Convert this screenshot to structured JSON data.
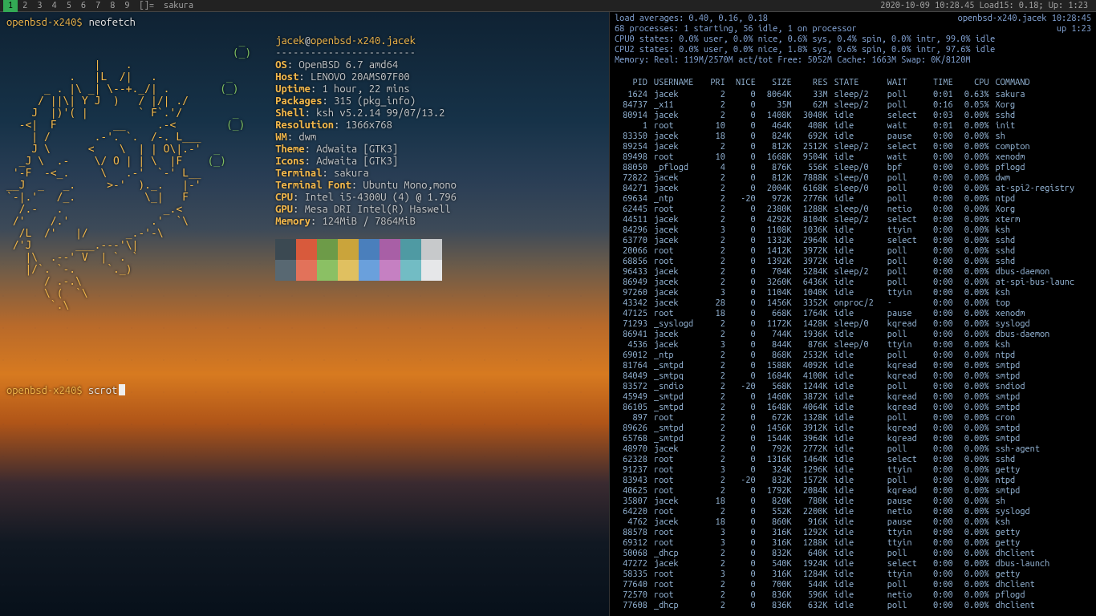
{
  "bar": {
    "tags": [
      "1",
      "2",
      "3",
      "4",
      "5",
      "6",
      "7",
      "8",
      "9"
    ],
    "selected_tag": "1",
    "layout": "[]=",
    "window_title": "sakura",
    "status": "2020-10-09 10:28.45 Load15: 0.18; Up:   1:23"
  },
  "left": {
    "ps1": "openbsd-x240$",
    "cmd1": "neofetch",
    "cmd2": "scrot",
    "ascii": "                                     _\n                                    (_)\n              |    .\n          .   |L  /|   .           _\n      _ . |\\ _| \\--+._/| .        (_)\n     / ||\\| Y J  )   / |/| ./\n    J  |)'( |        ` F`.'/        _\n  -<|  F         __     .-<        (_)\n    | /       .-'. `.  /-. L___\n    J \\      <    \\  | | O\\|.-'  _\n  _J \\  .-    \\/ O | | \\  |F    (_)\n '-F  -<_.     \\   .-'  `-' L__\n__J  _   _.     >-'  )._.   |-'\n`-|.'   /_.           \\_|   F\n  /.-   .                _.<\n /'    /.'             .'  `\\\n  /L  /'   |/      _.-'-\\\n /'J       ___.---'\\|\n   |\\  .--' V  | `. `\n   |/`. `-.     `._)\n      / .-.\\\n      \\ (  `\\\n       `.\\",
    "user": "jacek",
    "host": "openbsd-x240.jacek",
    "sep": "------------------------",
    "fields": [
      [
        "OS",
        "OpenBSD 6.7 amd64"
      ],
      [
        "Host",
        "LENOVO 20AMS07F00"
      ],
      [
        "Uptime",
        "1 hour, 22 mins"
      ],
      [
        "Packages",
        "315 (pkg_info)"
      ],
      [
        "Shell",
        "ksh v5.2.14 99/07/13.2"
      ],
      [
        "Resolution",
        "1366x768"
      ],
      [
        "WM",
        "dwm"
      ],
      [
        "Theme",
        "Adwaita [GTK3]"
      ],
      [
        "Icons",
        "Adwaita [GTK3]"
      ],
      [
        "Terminal",
        "sakura"
      ],
      [
        "Terminal Font",
        "Ubuntu Mono,mono"
      ],
      [
        "CPU",
        "Intel i5-4300U (4) @ 1.796"
      ],
      [
        "GPU",
        "Mesa DRI Intel(R) Haswell"
      ],
      [
        "Memory",
        "124MiB / 7864MiB"
      ]
    ],
    "swatches1": [
      "#3b4952",
      "#d85a3c",
      "#6d9b48",
      "#caa43b",
      "#4a7fbc",
      "#a85fa6",
      "#4f9aa3",
      "#c7c9cb"
    ],
    "swatches2": [
      "#586872",
      "#e2725a",
      "#8bc064",
      "#e0c060",
      "#6aa0dc",
      "#c580c2",
      "#72bcc4",
      "#e6e7e9"
    ]
  },
  "right": {
    "head1_left": "load averages:  0.40,  0.16,  0.18",
    "head1_right": "openbsd-x240.jacek 10:28:45",
    "head2_left": "68 processes: 1 starting, 56 idle, 1 on processor",
    "head2_right": "up  1:23",
    "cpu0": "CPU0 states:  0.0% user,  0.0% nice,  0.6% sys,  0.4% spin,  0.0% intr, 99.0% idle",
    "cpu2": "CPU2 states:  0.0% user,  0.0% nice,  1.8% sys,  0.6% spin,  0.0% intr, 97.6% idle",
    "mem": "Memory: Real: 119M/2570M act/tot Free: 5052M Cache: 1663M Swap: 0K/8120M",
    "cols": [
      "PID",
      "USERNAME",
      "PRI",
      "NICE",
      "SIZE",
      "RES",
      "STATE",
      "WAIT",
      "TIME",
      "CPU",
      "COMMAND"
    ],
    "rows": [
      [
        "1624",
        "jacek",
        "2",
        "0",
        "8064K",
        "33M",
        "sleep/2",
        "poll",
        "0:01",
        "0.63%",
        "sakura"
      ],
      [
        "84737",
        "_x11",
        "2",
        "0",
        "35M",
        "62M",
        "sleep/2",
        "poll",
        "0:16",
        "0.05%",
        "Xorg"
      ],
      [
        "80914",
        "jacek",
        "2",
        "0",
        "1408K",
        "3040K",
        "idle",
        "select",
        "0:03",
        "0.00%",
        "sshd"
      ],
      [
        "1",
        "root",
        "10",
        "0",
        "464K",
        "408K",
        "idle",
        "wait",
        "0:01",
        "0.00%",
        "init"
      ],
      [
        "83350",
        "jacek",
        "18",
        "0",
        "824K",
        "692K",
        "idle",
        "pause",
        "0:00",
        "0.00%",
        "sh"
      ],
      [
        "89254",
        "jacek",
        "2",
        "0",
        "812K",
        "2512K",
        "sleep/2",
        "select",
        "0:00",
        "0.00%",
        "compton"
      ],
      [
        "89498",
        "root",
        "10",
        "0",
        "1668K",
        "9504K",
        "idle",
        "wait",
        "0:00",
        "0.00%",
        "xenodm"
      ],
      [
        "88050",
        "_pflogd",
        "4",
        "0",
        "876K",
        "556K",
        "sleep/0",
        "bpf",
        "0:00",
        "0.00%",
        "pflogd"
      ],
      [
        "72822",
        "jacek",
        "2",
        "0",
        "812K",
        "7888K",
        "sleep/0",
        "poll",
        "0:00",
        "0.00%",
        "dwm"
      ],
      [
        "84271",
        "jacek",
        "2",
        "0",
        "2004K",
        "6168K",
        "sleep/0",
        "poll",
        "0:00",
        "0.00%",
        "at-spi2-registry"
      ],
      [
        "69634",
        "_ntp",
        "2",
        "-20",
        "972K",
        "2776K",
        "idle",
        "poll",
        "0:00",
        "0.00%",
        "ntpd"
      ],
      [
        "62445",
        "root",
        "2",
        "0",
        "2380K",
        "1288K",
        "sleep/0",
        "netio",
        "0:00",
        "0.00%",
        "Xorg"
      ],
      [
        "44511",
        "jacek",
        "2",
        "0",
        "4292K",
        "8104K",
        "sleep/2",
        "select",
        "0:00",
        "0.00%",
        "xterm"
      ],
      [
        "84296",
        "jacek",
        "3",
        "0",
        "1108K",
        "1036K",
        "idle",
        "ttyin",
        "0:00",
        "0.00%",
        "ksh"
      ],
      [
        "63770",
        "jacek",
        "2",
        "0",
        "1332K",
        "2964K",
        "idle",
        "select",
        "0:00",
        "0.00%",
        "sshd"
      ],
      [
        "20066",
        "root",
        "2",
        "0",
        "1412K",
        "3972K",
        "idle",
        "poll",
        "0:00",
        "0.00%",
        "sshd"
      ],
      [
        "68856",
        "root",
        "2",
        "0",
        "1392K",
        "3972K",
        "idle",
        "poll",
        "0:00",
        "0.00%",
        "sshd"
      ],
      [
        "96433",
        "jacek",
        "2",
        "0",
        "704K",
        "5284K",
        "sleep/2",
        "poll",
        "0:00",
        "0.00%",
        "dbus-daemon"
      ],
      [
        "86949",
        "jacek",
        "2",
        "0",
        "3260K",
        "6436K",
        "idle",
        "poll",
        "0:00",
        "0.00%",
        "at-spi-bus-launc"
      ],
      [
        "97260",
        "jacek",
        "3",
        "0",
        "1104K",
        "1040K",
        "idle",
        "ttyin",
        "0:00",
        "0.00%",
        "ksh"
      ],
      [
        "43342",
        "jacek",
        "28",
        "0",
        "1456K",
        "3352K",
        "onproc/2",
        "-",
        "0:00",
        "0.00%",
        "top"
      ],
      [
        "47125",
        "root",
        "18",
        "0",
        "668K",
        "1764K",
        "idle",
        "pause",
        "0:00",
        "0.00%",
        "xenodm"
      ],
      [
        "71293",
        "_syslogd",
        "2",
        "0",
        "1172K",
        "1428K",
        "sleep/0",
        "kqread",
        "0:00",
        "0.00%",
        "syslogd"
      ],
      [
        "86941",
        "jacek",
        "2",
        "0",
        "744K",
        "1936K",
        "idle",
        "poll",
        "0:00",
        "0.00%",
        "dbus-daemon"
      ],
      [
        "4536",
        "jacek",
        "3",
        "0",
        "844K",
        "876K",
        "sleep/0",
        "ttyin",
        "0:00",
        "0.00%",
        "ksh"
      ],
      [
        "69012",
        "_ntp",
        "2",
        "0",
        "868K",
        "2532K",
        "idle",
        "poll",
        "0:00",
        "0.00%",
        "ntpd"
      ],
      [
        "81764",
        "_smtpd",
        "2",
        "0",
        "1588K",
        "4092K",
        "idle",
        "kqread",
        "0:00",
        "0.00%",
        "smtpd"
      ],
      [
        "84049",
        "_smtpq",
        "2",
        "0",
        "1684K",
        "4100K",
        "idle",
        "kqread",
        "0:00",
        "0.00%",
        "smtpd"
      ],
      [
        "83572",
        "_sndio",
        "2",
        "-20",
        "568K",
        "1244K",
        "idle",
        "poll",
        "0:00",
        "0.00%",
        "sndiod"
      ],
      [
        "45949",
        "_smtpd",
        "2",
        "0",
        "1460K",
        "3872K",
        "idle",
        "kqread",
        "0:00",
        "0.00%",
        "smtpd"
      ],
      [
        "86105",
        "_smtpd",
        "2",
        "0",
        "1648K",
        "4064K",
        "idle",
        "kqread",
        "0:00",
        "0.00%",
        "smtpd"
      ],
      [
        "897",
        "root",
        "2",
        "0",
        "672K",
        "1328K",
        "idle",
        "poll",
        "0:00",
        "0.00%",
        "cron"
      ],
      [
        "89626",
        "_smtpd",
        "2",
        "0",
        "1456K",
        "3912K",
        "idle",
        "kqread",
        "0:00",
        "0.00%",
        "smtpd"
      ],
      [
        "65768",
        "_smtpd",
        "2",
        "0",
        "1544K",
        "3964K",
        "idle",
        "kqread",
        "0:00",
        "0.00%",
        "smtpd"
      ],
      [
        "48970",
        "jacek",
        "2",
        "0",
        "792K",
        "2772K",
        "idle",
        "poll",
        "0:00",
        "0.00%",
        "ssh-agent"
      ],
      [
        "62328",
        "root",
        "2",
        "0",
        "1316K",
        "1464K",
        "idle",
        "select",
        "0:00",
        "0.00%",
        "sshd"
      ],
      [
        "91237",
        "root",
        "3",
        "0",
        "324K",
        "1296K",
        "idle",
        "ttyin",
        "0:00",
        "0.00%",
        "getty"
      ],
      [
        "83943",
        "root",
        "2",
        "-20",
        "832K",
        "1572K",
        "idle",
        "poll",
        "0:00",
        "0.00%",
        "ntpd"
      ],
      [
        "40625",
        "root",
        "2",
        "0",
        "1792K",
        "2084K",
        "idle",
        "kqread",
        "0:00",
        "0.00%",
        "smtpd"
      ],
      [
        "35807",
        "jacek",
        "18",
        "0",
        "820K",
        "780K",
        "idle",
        "pause",
        "0:00",
        "0.00%",
        "sh"
      ],
      [
        "64220",
        "root",
        "2",
        "0",
        "552K",
        "2200K",
        "idle",
        "netio",
        "0:00",
        "0.00%",
        "syslogd"
      ],
      [
        "4762",
        "jacek",
        "18",
        "0",
        "860K",
        "916K",
        "idle",
        "pause",
        "0:00",
        "0.00%",
        "ksh"
      ],
      [
        "88578",
        "root",
        "3",
        "0",
        "316K",
        "1292K",
        "idle",
        "ttyin",
        "0:00",
        "0.00%",
        "getty"
      ],
      [
        "69312",
        "root",
        "3",
        "0",
        "316K",
        "1288K",
        "idle",
        "ttyin",
        "0:00",
        "0.00%",
        "getty"
      ],
      [
        "50068",
        "_dhcp",
        "2",
        "0",
        "832K",
        "640K",
        "idle",
        "poll",
        "0:00",
        "0.00%",
        "dhclient"
      ],
      [
        "47272",
        "jacek",
        "2",
        "0",
        "540K",
        "1924K",
        "idle",
        "select",
        "0:00",
        "0.00%",
        "dbus-launch"
      ],
      [
        "58335",
        "root",
        "3",
        "0",
        "316K",
        "1284K",
        "idle",
        "ttyin",
        "0:00",
        "0.00%",
        "getty"
      ],
      [
        "77640",
        "root",
        "2",
        "0",
        "700K",
        "544K",
        "idle",
        "poll",
        "0:00",
        "0.00%",
        "dhclient"
      ],
      [
        "72570",
        "root",
        "2",
        "0",
        "836K",
        "596K",
        "idle",
        "netio",
        "0:00",
        "0.00%",
        "pflogd"
      ],
      [
        "77608",
        "_dhcp",
        "2",
        "0",
        "836K",
        "632K",
        "idle",
        "poll",
        "0:00",
        "0.00%",
        "dhclient"
      ]
    ]
  }
}
